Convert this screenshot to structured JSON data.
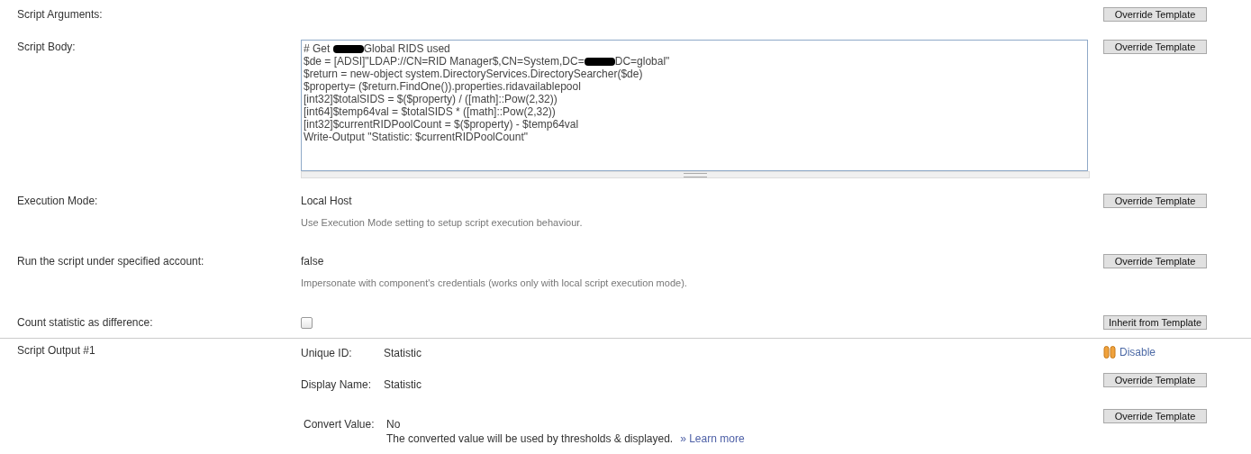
{
  "fields": [
    {
      "kind": "empty",
      "label": "Script Arguments:",
      "button": "Override Template"
    },
    {
      "kind": "script",
      "label": "Script Body:",
      "button": "Override Template",
      "lines": [
        {
          "parts": [
            "# Get ",
            "Global RIDS used"
          ]
        },
        {
          "parts": [
            "$de = [ADSI]\"LDAP://CN=RID Manager$,CN=System,DC=",
            "DC=global\""
          ]
        },
        {
          "parts": [
            "$return = new-object system.DirectoryServices.DirectorySearcher($de)"
          ]
        },
        {
          "parts": [
            "$property= ($return.FindOne()).properties.ridavailablepool"
          ]
        },
        {
          "parts": [
            "[int32]$totalSIDS = $($property) / ([math]::Pow(2,32))"
          ]
        },
        {
          "parts": [
            "[int64]$temp64val = $totalSIDS * ([math]::Pow(2,32))"
          ]
        },
        {
          "parts": [
            "[int32]$currentRIDPoolCount = $($property) - $temp64val"
          ]
        },
        {
          "parts": [
            "Write-Output \"Statistic: $currentRIDPoolCount\""
          ]
        }
      ]
    },
    {
      "kind": "text",
      "label": "Execution Mode:",
      "value": "Local Host",
      "hint": "Use Execution Mode setting to setup script execution behaviour.",
      "button": "Override Template"
    },
    {
      "kind": "text",
      "label": "Run the script under specified account:",
      "value": "false",
      "hint": "Impersonate with component's credentials (works only with local script execution mode).",
      "button": "Override Template"
    },
    {
      "kind": "checkbox",
      "label": "Count statistic as difference:",
      "checked": false,
      "button": "Inherit from Template"
    }
  ],
  "output": {
    "label": "Script Output #1",
    "rows": [
      {
        "label": "Unique ID:",
        "value": "Statistic",
        "action": {
          "kind": "link",
          "text": "Disable"
        }
      },
      {
        "label": "Display Name:",
        "value": "Statistic",
        "action": {
          "kind": "button",
          "text": "Override Template"
        }
      },
      {
        "label": "Convert Value:",
        "value": "No",
        "note": "The converted value will be used by thresholds & displayed.",
        "link": "» Learn more",
        "action": {
          "kind": "button",
          "text": "Override Template"
        }
      }
    ]
  }
}
